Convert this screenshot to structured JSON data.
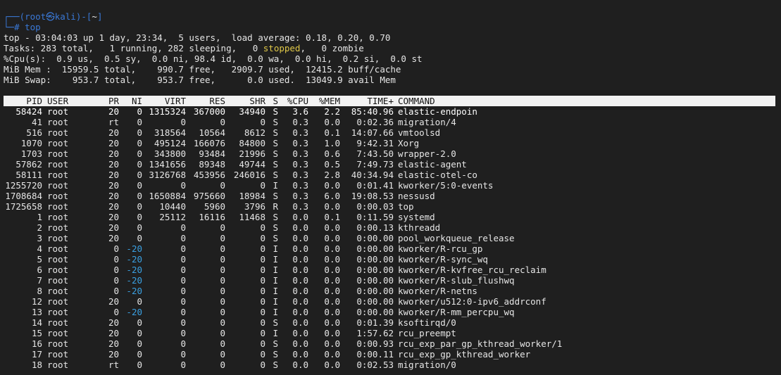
{
  "prompt": {
    "line1_left": "┌──(",
    "user": "root",
    "at": "㉿",
    "host": "kali",
    "mid": ")-[",
    "dir": "~",
    "end": "]",
    "line2_prefix": "└─",
    "hash": "#",
    "command": "top"
  },
  "summary": {
    "uptime": "top - 03:04:03 up 1 day, 23:34,  5 users,  load average: 0.18, 0.20, 0.70",
    "tasks_pre": "Tasks: 283 total,   1 running, 282 sleeping,   0 ",
    "tasks_stopped": "stopped",
    "tasks_post": ",   0 zombie",
    "cpu": "%Cpu(s):  0.9 us,  0.5 sy,  0.0 ni, 98.4 id,  0.0 wa,  0.0 hi,  0.2 si,  0.0 st",
    "mem": "MiB Mem :  15959.5 total,    990.7 free,   2909.7 used,  12415.2 buff/cache",
    "swap": "MiB Swap:    953.7 total,    953.7 free,      0.0 used.  13049.9 avail Mem"
  },
  "columns": [
    "PID",
    "USER",
    "PR",
    "NI",
    "VIRT",
    "RES",
    "SHR",
    "S",
    "%CPU",
    "%MEM",
    "TIME+",
    "COMMAND"
  ],
  "processes": [
    [
      "58424",
      "root",
      "20",
      "0",
      "1315324",
      "367000",
      "34940",
      "S",
      "3.6",
      "2.2",
      "85:40.96",
      "elastic-endpoin"
    ],
    [
      "41",
      "root",
      "rt",
      "0",
      "0",
      "0",
      "0",
      "S",
      "0.3",
      "0.0",
      "0:02.36",
      "migration/4"
    ],
    [
      "516",
      "root",
      "20",
      "0",
      "318564",
      "10564",
      "8612",
      "S",
      "0.3",
      "0.1",
      "14:07.66",
      "vmtoolsd"
    ],
    [
      "1070",
      "root",
      "20",
      "0",
      "495124",
      "166076",
      "84800",
      "S",
      "0.3",
      "1.0",
      "9:42.31",
      "Xorg"
    ],
    [
      "1703",
      "root",
      "20",
      "0",
      "343800",
      "93484",
      "21996",
      "S",
      "0.3",
      "0.6",
      "7:43.50",
      "wrapper-2.0"
    ],
    [
      "57862",
      "root",
      "20",
      "0",
      "1341656",
      "89348",
      "49744",
      "S",
      "0.3",
      "0.5",
      "7:49.73",
      "elastic-agent"
    ],
    [
      "58111",
      "root",
      "20",
      "0",
      "3126768",
      "453956",
      "246016",
      "S",
      "0.3",
      "2.8",
      "40:34.94",
      "elastic-otel-co"
    ],
    [
      "1255720",
      "root",
      "20",
      "0",
      "0",
      "0",
      "0",
      "I",
      "0.3",
      "0.0",
      "0:01.41",
      "kworker/5:0-events"
    ],
    [
      "1708684",
      "root",
      "20",
      "0",
      "1650884",
      "975660",
      "18984",
      "S",
      "0.3",
      "6.0",
      "19:08.53",
      "nessusd"
    ],
    [
      "1725658",
      "root",
      "20",
      "0",
      "10440",
      "5960",
      "3796",
      "R",
      "0.3",
      "0.0",
      "0:00.03",
      "top"
    ],
    [
      "1",
      "root",
      "20",
      "0",
      "25112",
      "16116",
      "11468",
      "S",
      "0.0",
      "0.1",
      "0:11.59",
      "systemd"
    ],
    [
      "2",
      "root",
      "20",
      "0",
      "0",
      "0",
      "0",
      "S",
      "0.0",
      "0.0",
      "0:00.13",
      "kthreadd"
    ],
    [
      "3",
      "root",
      "20",
      "0",
      "0",
      "0",
      "0",
      "S",
      "0.0",
      "0.0",
      "0:00.00",
      "pool_workqueue_release"
    ],
    [
      "4",
      "root",
      "0",
      "-20",
      "0",
      "0",
      "0",
      "I",
      "0.0",
      "0.0",
      "0:00.00",
      "kworker/R-rcu_gp"
    ],
    [
      "5",
      "root",
      "0",
      "-20",
      "0",
      "0",
      "0",
      "I",
      "0.0",
      "0.0",
      "0:00.00",
      "kworker/R-sync_wq"
    ],
    [
      "6",
      "root",
      "0",
      "-20",
      "0",
      "0",
      "0",
      "I",
      "0.0",
      "0.0",
      "0:00.00",
      "kworker/R-kvfree_rcu_reclaim"
    ],
    [
      "7",
      "root",
      "0",
      "-20",
      "0",
      "0",
      "0",
      "I",
      "0.0",
      "0.0",
      "0:00.00",
      "kworker/R-slub_flushwq"
    ],
    [
      "8",
      "root",
      "0",
      "-20",
      "0",
      "0",
      "0",
      "I",
      "0.0",
      "0.0",
      "0:00.00",
      "kworker/R-netns"
    ],
    [
      "12",
      "root",
      "20",
      "0",
      "0",
      "0",
      "0",
      "I",
      "0.0",
      "0.0",
      "0:00.00",
      "kworker/u512:0-ipv6_addrconf"
    ],
    [
      "13",
      "root",
      "0",
      "-20",
      "0",
      "0",
      "0",
      "I",
      "0.0",
      "0.0",
      "0:00.00",
      "kworker/R-mm_percpu_wq"
    ],
    [
      "14",
      "root",
      "20",
      "0",
      "0",
      "0",
      "0",
      "S",
      "0.0",
      "0.0",
      "0:01.39",
      "ksoftirqd/0"
    ],
    [
      "15",
      "root",
      "20",
      "0",
      "0",
      "0",
      "0",
      "I",
      "0.0",
      "0.0",
      "1:57.62",
      "rcu_preempt"
    ],
    [
      "16",
      "root",
      "20",
      "0",
      "0",
      "0",
      "0",
      "S",
      "0.0",
      "0.0",
      "0:00.93",
      "rcu_exp_par_gp_kthread_worker/1"
    ],
    [
      "17",
      "root",
      "20",
      "0",
      "0",
      "0",
      "0",
      "S",
      "0.0",
      "0.0",
      "0:00.11",
      "rcu_exp_gp_kthread_worker"
    ],
    [
      "18",
      "root",
      "rt",
      "0",
      "0",
      "0",
      "0",
      "S",
      "0.0",
      "0.0",
      "0:02.53",
      "migration/0"
    ]
  ],
  "colors": {
    "background": "#1f1f1f",
    "prompt_blue": "#3a78d6",
    "stopped_yellow": "#e0c848",
    "negative_nice": "#3a9fe0",
    "header_bg": "#f2f2f2"
  }
}
